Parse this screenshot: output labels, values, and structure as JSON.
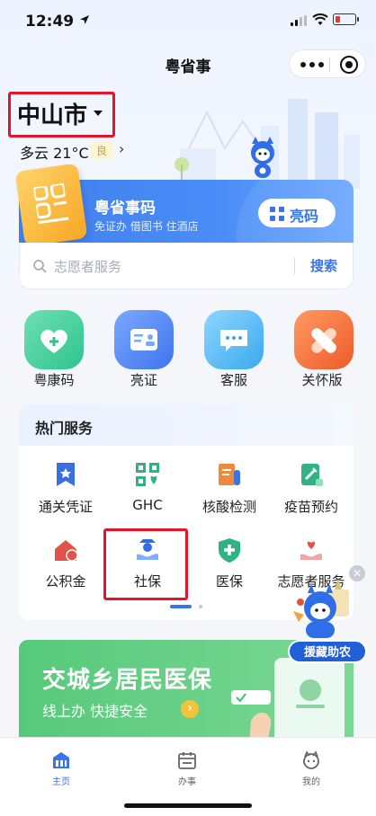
{
  "status_bar": {
    "time": "12:49"
  },
  "nav": {
    "title": "粤省事"
  },
  "location": {
    "city": "中山市",
    "weather": "多云 21°C",
    "aqi": "良"
  },
  "code_card": {
    "title": "粤省事码",
    "subtitle": "免证办 借图书 住酒店",
    "button_label": "亮码"
  },
  "search": {
    "placeholder": "志愿者服务",
    "button_label": "搜索"
  },
  "quick_actions": [
    {
      "label": "粤康码",
      "icon": "heart-icon",
      "color": "#3fce9a"
    },
    {
      "label": "亮证",
      "icon": "id-card-icon",
      "color": "#4f86f5"
    },
    {
      "label": "客服",
      "icon": "chat-bubble-icon",
      "color": "#48b6f3"
    },
    {
      "label": "关怀版",
      "icon": "bandage-icon",
      "color": "#f06a3a"
    }
  ],
  "hot_services": {
    "title": "热门服务",
    "items": [
      {
        "label": "通关凭证",
        "icon": "pass-certificate-icon"
      },
      {
        "label": "GHC",
        "icon": "ghc-icon"
      },
      {
        "label": "核酸检测",
        "icon": "nucleic-test-icon"
      },
      {
        "label": "疫苗预约",
        "icon": "vaccine-icon"
      },
      {
        "label": "公积金",
        "icon": "housing-fund-icon"
      },
      {
        "label": "社保",
        "icon": "social-security-icon"
      },
      {
        "label": "医保",
        "icon": "medical-insurance-icon"
      },
      {
        "label": "志愿者服务",
        "icon": "volunteer-icon"
      }
    ]
  },
  "floating_badge": {
    "label": "援藏助农"
  },
  "banner": {
    "title": "交城乡居民医保",
    "subtitle": "线上办 快捷安全"
  },
  "tabs": [
    {
      "label": "主页",
      "icon": "home-icon",
      "active": true
    },
    {
      "label": "办事",
      "icon": "calendar-icon",
      "active": false
    },
    {
      "label": "我的",
      "icon": "profile-icon",
      "active": false
    }
  ],
  "colors": {
    "accent": "#3a74e8",
    "highlight_box": "#e5142b"
  }
}
